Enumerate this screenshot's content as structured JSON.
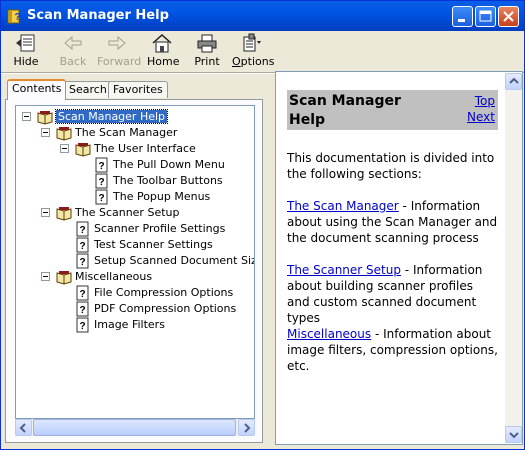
{
  "window": {
    "title": "Scan Manager Help"
  },
  "toolbar": {
    "hide": "Hide",
    "back": "Back",
    "forward": "Forward",
    "home": "Home",
    "print": "Print",
    "options": "Options"
  },
  "tabs": {
    "contents": "Contents",
    "search": "Search",
    "favorites": "Favorites"
  },
  "tree": [
    {
      "label": "Scan Manager Help"
    },
    {
      "label": "The Scan Manager"
    },
    {
      "label": "The User Interface"
    },
    {
      "label": "The Pull Down Menu"
    },
    {
      "label": "The Toolbar Buttons"
    },
    {
      "label": "The Popup Menus"
    },
    {
      "label": "The Scanner Setup"
    },
    {
      "label": "Scanner Profile Settings"
    },
    {
      "label": "Test Scanner Settings"
    },
    {
      "label": "Setup Scanned Document Sizes"
    },
    {
      "label": "Miscellaneous"
    },
    {
      "label": "File Compression Options"
    },
    {
      "label": "PDF Compression Options"
    },
    {
      "label": "Image Filters"
    }
  ],
  "content": {
    "title": "Scan Manager Help",
    "top_link": "Top",
    "next_link": "Next",
    "intro": "This documentation is divided into the following sections:",
    "sections": [
      {
        "link": "The Scan Manager",
        "text": " - Information about using the Scan Manager and the document scanning process"
      },
      {
        "link": "The Scanner Setup",
        "text": " - Information about building scanner profiles and custom scanned document types"
      },
      {
        "link": "Miscellaneous",
        "text": " - Information about image filters, compression options, etc."
      }
    ]
  },
  "colors": {
    "title_bar": "#0054e3",
    "selection": "#316ac5",
    "link": "#0000cc",
    "banner": "#c0c0c0"
  }
}
